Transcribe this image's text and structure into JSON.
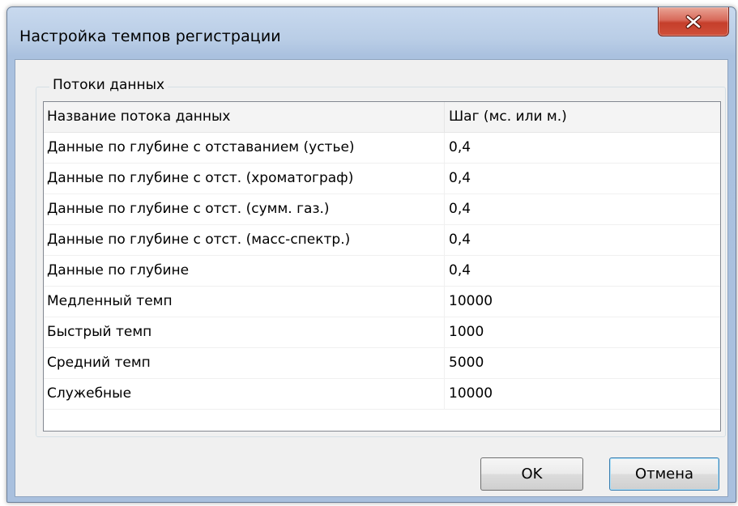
{
  "window": {
    "title": "Настройка темпов регистрации"
  },
  "group": {
    "label": "Потоки данных"
  },
  "table": {
    "columns": [
      "Название потока данных",
      "Шаг (мс. или м.)"
    ],
    "rows": [
      [
        "Данные по глубине с отставанием (устье)",
        "0,4"
      ],
      [
        "Данные по глубине с отст. (хроматограф)",
        "0,4"
      ],
      [
        "Данные по глубине с отст. (сумм. газ.)",
        "0,4"
      ],
      [
        "Данные по глубине с отст. (масс-спектр.)",
        "0,4"
      ],
      [
        "Данные по глубине",
        "0,4"
      ],
      [
        "Медленный темп",
        "10000"
      ],
      [
        "Быстрый темп",
        "1000"
      ],
      [
        "Средний темп",
        "5000"
      ],
      [
        "Служебные",
        "10000"
      ]
    ]
  },
  "buttons": {
    "ok": "OK",
    "cancel": "Отмена"
  },
  "icons": {
    "close": "close-icon"
  }
}
